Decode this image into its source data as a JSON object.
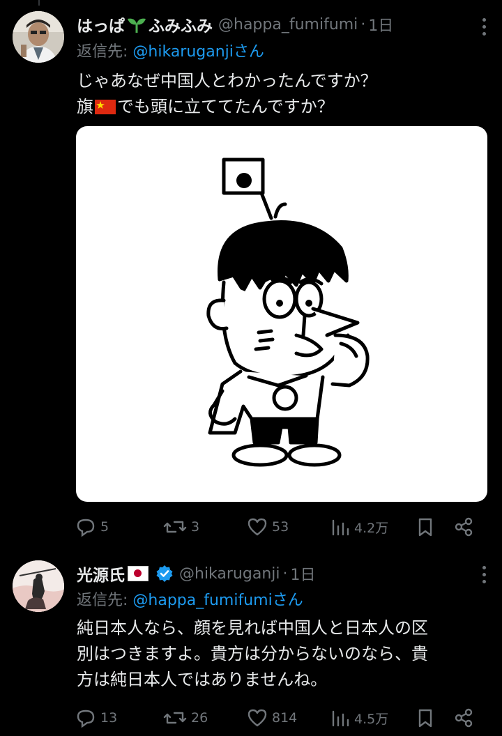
{
  "tweets": [
    {
      "display_name": "はっぱ",
      "display_name_suffix": "ふみふみ",
      "handle": "@happa_fumifumi",
      "separator": "·",
      "time": "1日",
      "reply_prefix": "返信先: ",
      "reply_mention": "@hikaruganji",
      "reply_suffix": "さん",
      "text_line1": "じゃあなぜ中国人とわかったんですか？",
      "text_line2_pre": "旗",
      "text_line2_post": "でも頭に立ててたんですか？",
      "replies": "5",
      "reposts": "3",
      "likes": "53",
      "views": "4.2万"
    },
    {
      "display_name": "光源氏",
      "handle": "@hikaruganji",
      "separator": "·",
      "time": "1日",
      "reply_prefix": "返信先: ",
      "reply_mention": "@happa_fumifumi",
      "reply_suffix": "さん",
      "text_line1": "純日本人なら、顔を見れば中国人と日本人の区",
      "text_line2": "別はつきますよ。貴方は分からないのなら、貴",
      "text_line3": "方は純日本人ではありませんね。",
      "replies": "13",
      "reposts": "26",
      "likes": "814",
      "views": "4.5万"
    }
  ],
  "colors": {
    "background": "#000000",
    "text": "#e7e9ea",
    "secondary": "#71767b",
    "link": "#1d9bf0",
    "sprout": "#4caf50",
    "verified": "#1d9bf0"
  },
  "icons": [
    "reply-icon",
    "repost-icon",
    "like-icon",
    "views-icon",
    "bookmark-icon",
    "share-icon",
    "more-icon",
    "verified-badge-icon"
  ]
}
